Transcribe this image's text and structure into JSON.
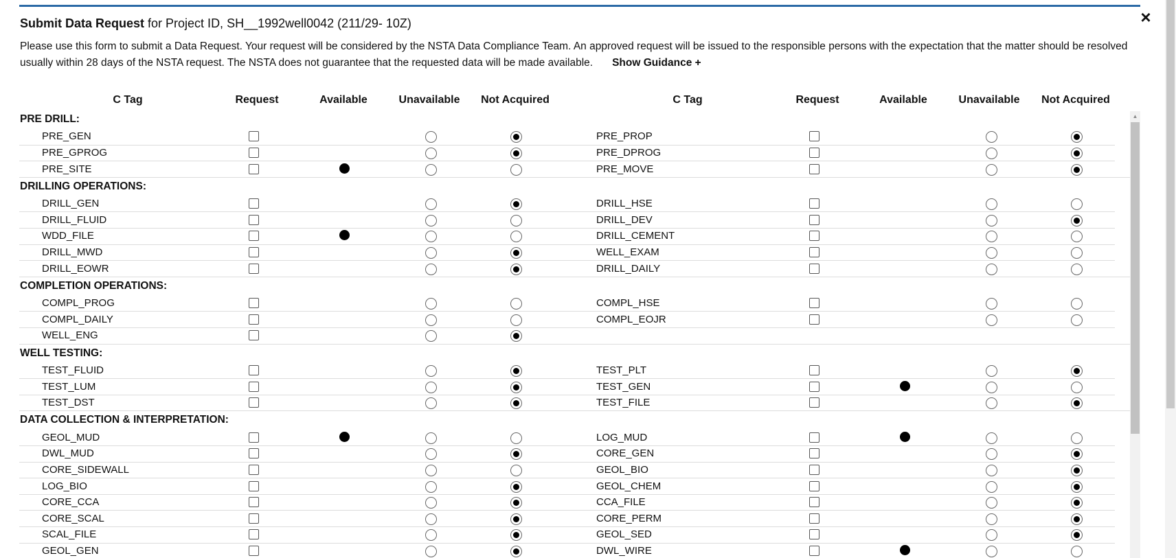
{
  "dialog": {
    "title_bold": "Submit Data Request",
    "title_rest": " for Project ID, SH__1992well0042 (211/29- 10Z)",
    "intro": "Please use this form to submit a Data Request. Your request will be considered by the NSTA Data Compliance Team. An approved request will be issued to the responsible persons with the expectation that the matter should be resolved usually within 28 days of the NSTA request. The NSTA does not guarantee that the requested data will be made available.",
    "guidance_link": "Show Guidance +",
    "close_label": "×"
  },
  "headers": {
    "ctag": "C Tag",
    "request": "Request",
    "available": "Available",
    "unavailable": "Unavailable",
    "not_acquired": "Not Acquired"
  },
  "sections": [
    {
      "title": "PRE DRILL:",
      "rows": [
        [
          {
            "tag": "PRE_GEN",
            "available": false,
            "status": "not_acquired"
          },
          {
            "tag": "PRE_PROP",
            "available": false,
            "status": "not_acquired"
          }
        ],
        [
          {
            "tag": "PRE_GPROG",
            "available": false,
            "status": "not_acquired"
          },
          {
            "tag": "PRE_DPROG",
            "available": false,
            "status": "not_acquired"
          }
        ],
        [
          {
            "tag": "PRE_SITE",
            "available": true,
            "status": "none"
          },
          {
            "tag": "PRE_MOVE",
            "available": false,
            "status": "not_acquired"
          }
        ]
      ]
    },
    {
      "title": "DRILLING OPERATIONS:",
      "rows": [
        [
          {
            "tag": "DRILL_GEN",
            "available": false,
            "status": "not_acquired"
          },
          {
            "tag": "DRILL_HSE",
            "available": false,
            "status": "none"
          }
        ],
        [
          {
            "tag": "DRILL_FLUID",
            "available": false,
            "status": "none"
          },
          {
            "tag": "DRILL_DEV",
            "available": false,
            "status": "not_acquired"
          }
        ],
        [
          {
            "tag": "WDD_FILE",
            "available": true,
            "status": "none"
          },
          {
            "tag": "DRILL_CEMENT",
            "available": false,
            "status": "none"
          }
        ],
        [
          {
            "tag": "DRILL_MWD",
            "available": false,
            "status": "not_acquired"
          },
          {
            "tag": "WELL_EXAM",
            "available": false,
            "status": "none"
          }
        ],
        [
          {
            "tag": "DRILL_EOWR",
            "available": false,
            "status": "not_acquired"
          },
          {
            "tag": "DRILL_DAILY",
            "available": false,
            "status": "none"
          }
        ]
      ]
    },
    {
      "title": "COMPLETION OPERATIONS:",
      "rows": [
        [
          {
            "tag": "COMPL_PROG",
            "available": false,
            "status": "none"
          },
          {
            "tag": "COMPL_HSE",
            "available": false,
            "status": "none"
          }
        ],
        [
          {
            "tag": "COMPL_DAILY",
            "available": false,
            "status": "none"
          },
          {
            "tag": "COMPL_EOJR",
            "available": false,
            "status": "none"
          }
        ],
        [
          {
            "tag": "WELL_ENG",
            "available": false,
            "status": "not_acquired"
          },
          null
        ]
      ]
    },
    {
      "title": "WELL TESTING:",
      "rows": [
        [
          {
            "tag": "TEST_FLUID",
            "available": false,
            "status": "not_acquired"
          },
          {
            "tag": "TEST_PLT",
            "available": false,
            "status": "not_acquired"
          }
        ],
        [
          {
            "tag": "TEST_LUM",
            "available": false,
            "status": "not_acquired"
          },
          {
            "tag": "TEST_GEN",
            "available": true,
            "status": "none"
          }
        ],
        [
          {
            "tag": "TEST_DST",
            "available": false,
            "status": "not_acquired"
          },
          {
            "tag": "TEST_FILE",
            "available": false,
            "status": "not_acquired"
          }
        ]
      ]
    },
    {
      "title": "DATA COLLECTION & INTERPRETATION:",
      "rows": [
        [
          {
            "tag": "GEOL_MUD",
            "available": true,
            "status": "none"
          },
          {
            "tag": "LOG_MUD",
            "available": true,
            "status": "none"
          }
        ],
        [
          {
            "tag": "DWL_MUD",
            "available": false,
            "status": "not_acquired"
          },
          {
            "tag": "CORE_GEN",
            "available": false,
            "status": "not_acquired"
          }
        ],
        [
          {
            "tag": "CORE_SIDEWALL",
            "available": false,
            "status": "none"
          },
          {
            "tag": "GEOL_BIO",
            "available": false,
            "status": "not_acquired"
          }
        ],
        [
          {
            "tag": "LOG_BIO",
            "available": false,
            "status": "not_acquired"
          },
          {
            "tag": "GEOL_CHEM",
            "available": false,
            "status": "not_acquired"
          }
        ],
        [
          {
            "tag": "CORE_CCA",
            "available": false,
            "status": "not_acquired"
          },
          {
            "tag": "CCA_FILE",
            "available": false,
            "status": "not_acquired"
          }
        ],
        [
          {
            "tag": "CORE_SCAL",
            "available": false,
            "status": "not_acquired"
          },
          {
            "tag": "CORE_PERM",
            "available": false,
            "status": "not_acquired"
          }
        ],
        [
          {
            "tag": "SCAL_FILE",
            "available": false,
            "status": "not_acquired"
          },
          {
            "tag": "GEOL_SED",
            "available": false,
            "status": "not_acquired"
          }
        ],
        [
          {
            "tag": "GEOL_GEN",
            "available": false,
            "status": "not_acquired"
          },
          {
            "tag": "DWL_WIRE",
            "available": true,
            "status": "none"
          }
        ]
      ]
    }
  ]
}
